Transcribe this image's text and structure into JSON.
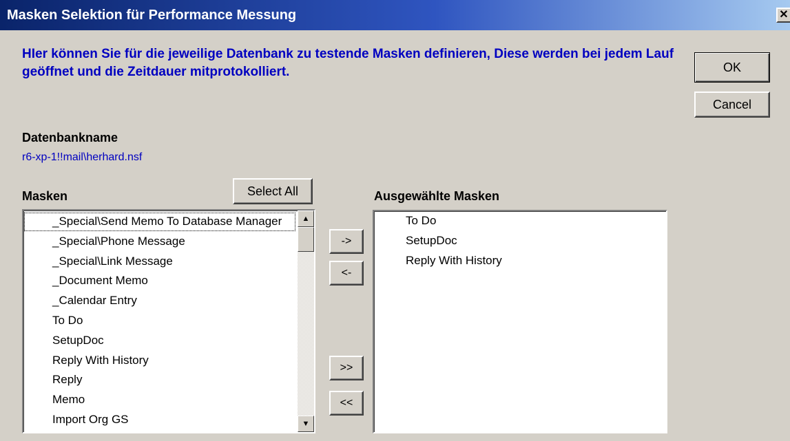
{
  "window": {
    "title": "Masken Selektion für Performance Messung",
    "close_glyph": "✕"
  },
  "description": "HIer können Sie für die jeweilige Datenbank zu testende Masken definieren, Diese werden bei jedem Lauf geöffnet und die Zeitdauer mitprotokolliert.",
  "buttons": {
    "ok": "OK",
    "cancel": "Cancel",
    "select_all": "Select All",
    "add": "->",
    "remove": "<-",
    "add_all": ">>",
    "remove_all": "<<"
  },
  "database": {
    "label": "Datenbankname",
    "value": "r6-xp-1!!mail\\herhard.nsf"
  },
  "masks": {
    "label": "Masken",
    "items": [
      "_Special\\Send Memo To Database Manager",
      "_Special\\Phone Message",
      "_Special\\Link Message",
      "_Document Memo",
      "_Calendar Entry",
      "To Do",
      "SetupDoc",
      "Reply With History",
      "Reply",
      "Memo",
      "Import Org GS"
    ],
    "scroll_up_glyph": "▲",
    "scroll_down_glyph": "▼"
  },
  "selected_masks": {
    "label": "Ausgewählte Masken",
    "items": [
      "To Do",
      "SetupDoc",
      "Reply With History"
    ]
  }
}
